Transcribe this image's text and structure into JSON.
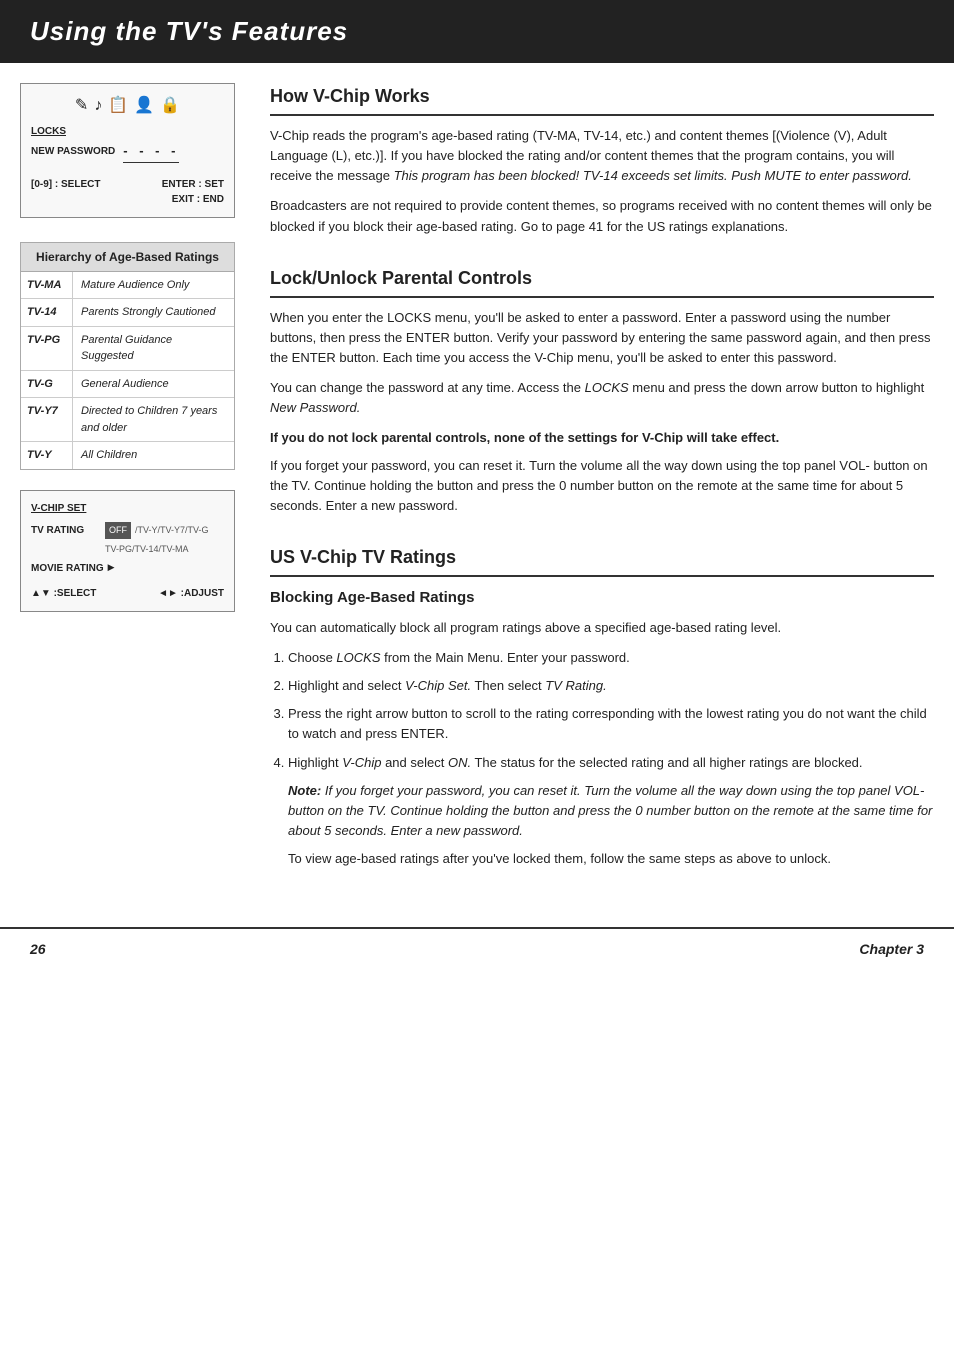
{
  "header": {
    "title": "Using the TV's Features"
  },
  "section_vchip_works": {
    "title": "How V-Chip Works",
    "para1": "V-Chip reads the program's age-based rating (TV-MA, TV-14, etc.) and content themes [(Violence (V), Adult Language (L), etc.)]. If you have blocked the rating and/or content themes that the program contains, you will receive the message ",
    "para1_italic": "This program has been blocked! TV-14 exceeds set limits. Push MUTE to enter password.",
    "para2": "Broadcasters are not required to provide content themes, so programs received with no content themes will only be blocked if you block their age-based rating. Go to page 41 for the US ratings explanations."
  },
  "section_lock": {
    "title": "Lock/Unlock Parental Controls",
    "para1": "When you enter the LOCKS menu, you'll be asked to enter a password. Enter a password using the number buttons, then press the ENTER button. Verify your password by entering the same password again, and then press the ENTER button. Each time you access the V-Chip menu, you'll be asked to enter this password.",
    "para2": "You can change the password at any time. Access the ",
    "para2_italic": "LOCKS",
    "para2_cont": " menu and press the down arrow button to highlight ",
    "para2_italic2": "New Password.",
    "bold_note": "If you do not lock parental controls, none of the settings for V-Chip will take effect.",
    "para3": "If you forget your password, you can reset it. Turn the volume all the way down using the top panel VOL- button on the TV. Continue holding the button and press the 0 number button on the remote at the same time for about 5 seconds. Enter a new password."
  },
  "lock_ui": {
    "label_locks": "LOCKS",
    "label_new_password": "NEW PASSWORD",
    "dashes": "- - - -",
    "bottom_left": "[0-9] : SELECT",
    "bottom_right_line1": "ENTER : SET",
    "bottom_right_line2": "EXIT : END",
    "icons": [
      "✏️",
      "🎵",
      "📋",
      "👤",
      "📋"
    ]
  },
  "section_ratings": {
    "title": "US V-Chip TV Ratings",
    "sub_blocking": "Blocking Age-Based Ratings",
    "para1": "You can automatically block all program ratings above a specified age-based rating level.",
    "steps": [
      {
        "text": "Choose ",
        "italic": "LOCKS",
        "text2": " from the Main Menu. Enter your password."
      },
      {
        "text": "Highlight and select ",
        "italic": "V-Chip Set.",
        "text2": " Then select ",
        "italic2": "TV Rating."
      },
      {
        "text": "Press the right arrow button to scroll to the rating corresponding with the lowest rating you do not want the child to watch and press ENTER."
      },
      {
        "text": "Highlight ",
        "italic": "V-Chip",
        "text2": " and select ",
        "italic2": "ON.",
        "text3": " The status for the selected rating and all higher ratings are blocked."
      }
    ],
    "note_label": "Note:",
    "note_text": "If you forget your password, you can reset it. Turn the volume all the way down using the top panel VOL- button on the TV. Continue holding the button and press the 0 number button on the remote at the same time for about 5 seconds. Enter a new password.",
    "para_after_note": "To view age-based ratings after you've locked them, follow the same steps as above to unlock."
  },
  "hierarchy_table": {
    "title": "Hierarchy of Age-Based Ratings",
    "rows": [
      {
        "rating": "TV-MA",
        "desc": "Mature Audience Only"
      },
      {
        "rating": "TV-14",
        "desc": "Parents Strongly Cautioned"
      },
      {
        "rating": "TV-PG",
        "desc": "Parental Guidance Suggested"
      },
      {
        "rating": "TV-G",
        "desc": "General Audience"
      },
      {
        "rating": "TV-Y7",
        "desc": "Directed to Children 7 years and older"
      },
      {
        "rating": "TV-Y",
        "desc": "All Children"
      }
    ]
  },
  "vchip_box": {
    "title": "V-CHIP SET",
    "row1_label": "TV RATING",
    "row1_bar": "OFF/TV-Y/TV-Y7/TV-G",
    "row1_highlight": "OFF",
    "row1_rest": "TV-PG/TV-14/TV-MA",
    "row2_label": "MOVIE RATING",
    "row2_arrow": "▶",
    "bottom_left": "▲▼ :SELECT",
    "bottom_right": "◄► :ADJUST"
  },
  "footer": {
    "page_number": "26",
    "chapter": "Chapter 3"
  }
}
